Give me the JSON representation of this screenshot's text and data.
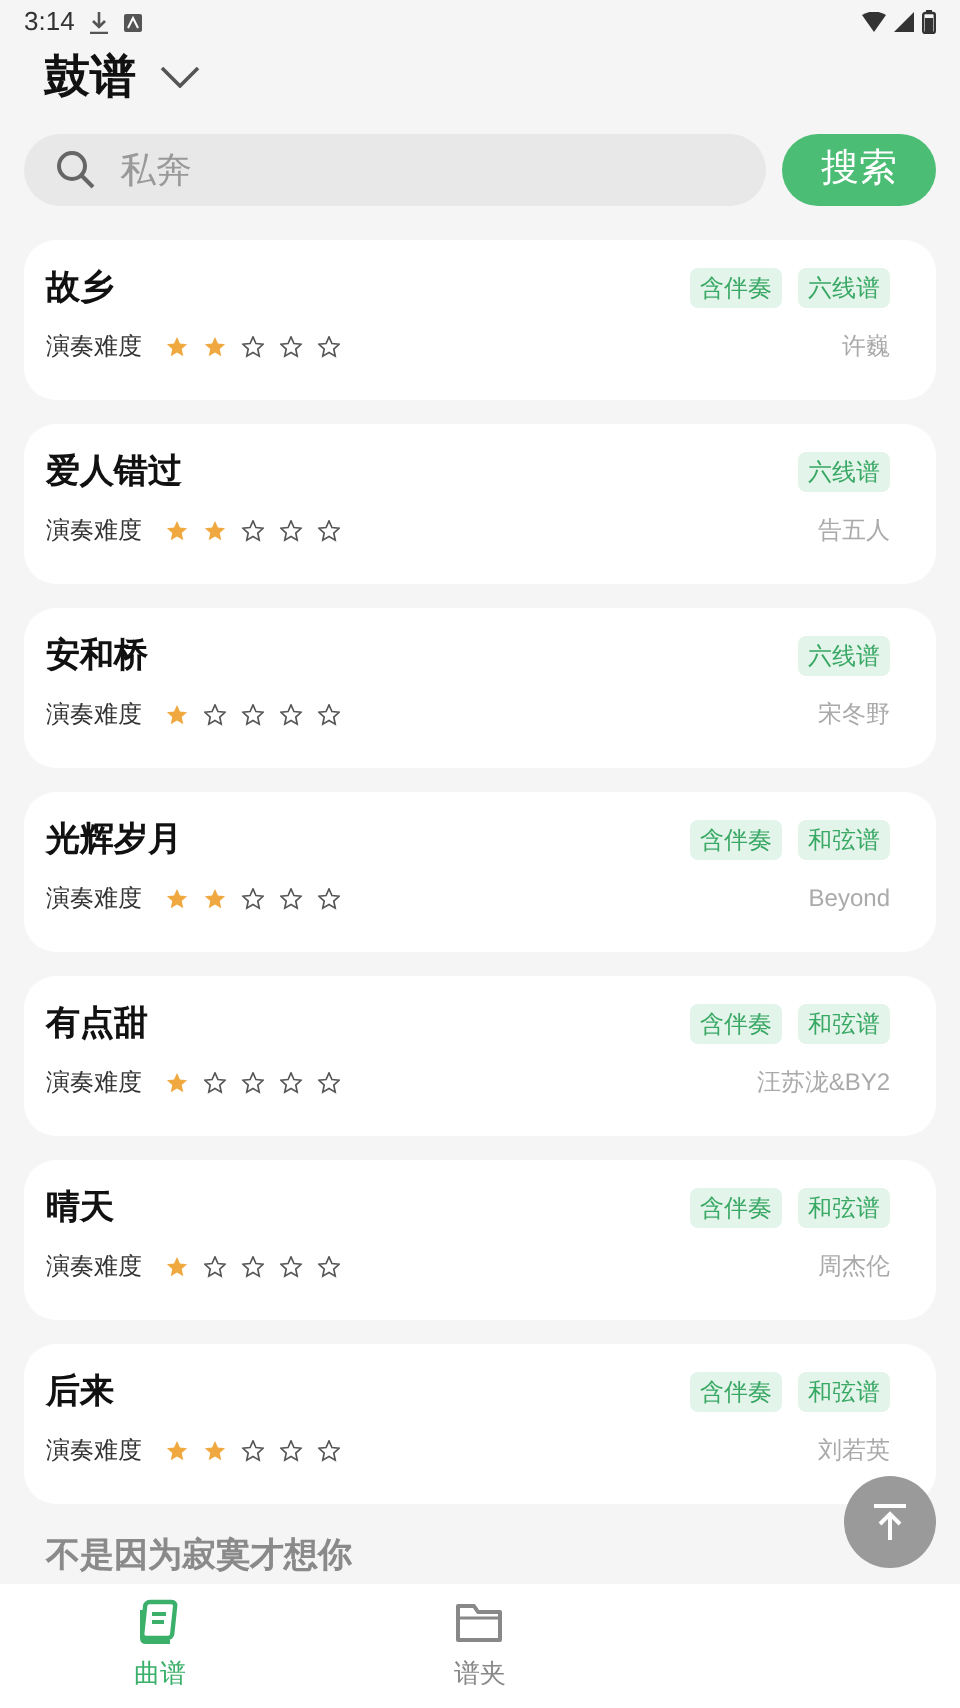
{
  "status_bar": {
    "time": "3:14"
  },
  "header": {
    "title": "鼓谱"
  },
  "search": {
    "placeholder": "私奔",
    "button": "搜索"
  },
  "songs": [
    {
      "title": "故乡",
      "tags": [
        "含伴奏",
        "六线谱"
      ],
      "difficulty_label": "演奏难度",
      "stars": 2,
      "artist": "许巍"
    },
    {
      "title": "爱人错过",
      "tags": [
        "六线谱"
      ],
      "difficulty_label": "演奏难度",
      "stars": 2,
      "artist": "告五人"
    },
    {
      "title": "安和桥",
      "tags": [
        "六线谱"
      ],
      "difficulty_label": "演奏难度",
      "stars": 1,
      "artist": "宋冬野"
    },
    {
      "title": "光辉岁月",
      "tags": [
        "含伴奏",
        "和弦谱"
      ],
      "difficulty_label": "演奏难度",
      "stars": 2,
      "artist": "Beyond"
    },
    {
      "title": "有点甜",
      "tags": [
        "含伴奏",
        "和弦谱"
      ],
      "difficulty_label": "演奏难度",
      "stars": 1,
      "artist": "汪苏泷&BY2"
    },
    {
      "title": "晴天",
      "tags": [
        "含伴奏",
        "和弦谱"
      ],
      "difficulty_label": "演奏难度",
      "stars": 1,
      "artist": "周杰伦"
    },
    {
      "title": "后来",
      "tags": [
        "含伴奏",
        "和弦谱"
      ],
      "difficulty_label": "演奏难度",
      "stars": 2,
      "artist": "刘若英"
    }
  ],
  "partial_song": {
    "title": "不是因为寂寞才想你"
  },
  "bottom_nav": [
    {
      "label": "曲谱",
      "kind": "book",
      "selected": true
    },
    {
      "label": "谱夹",
      "kind": "folder",
      "selected": false
    }
  ]
}
